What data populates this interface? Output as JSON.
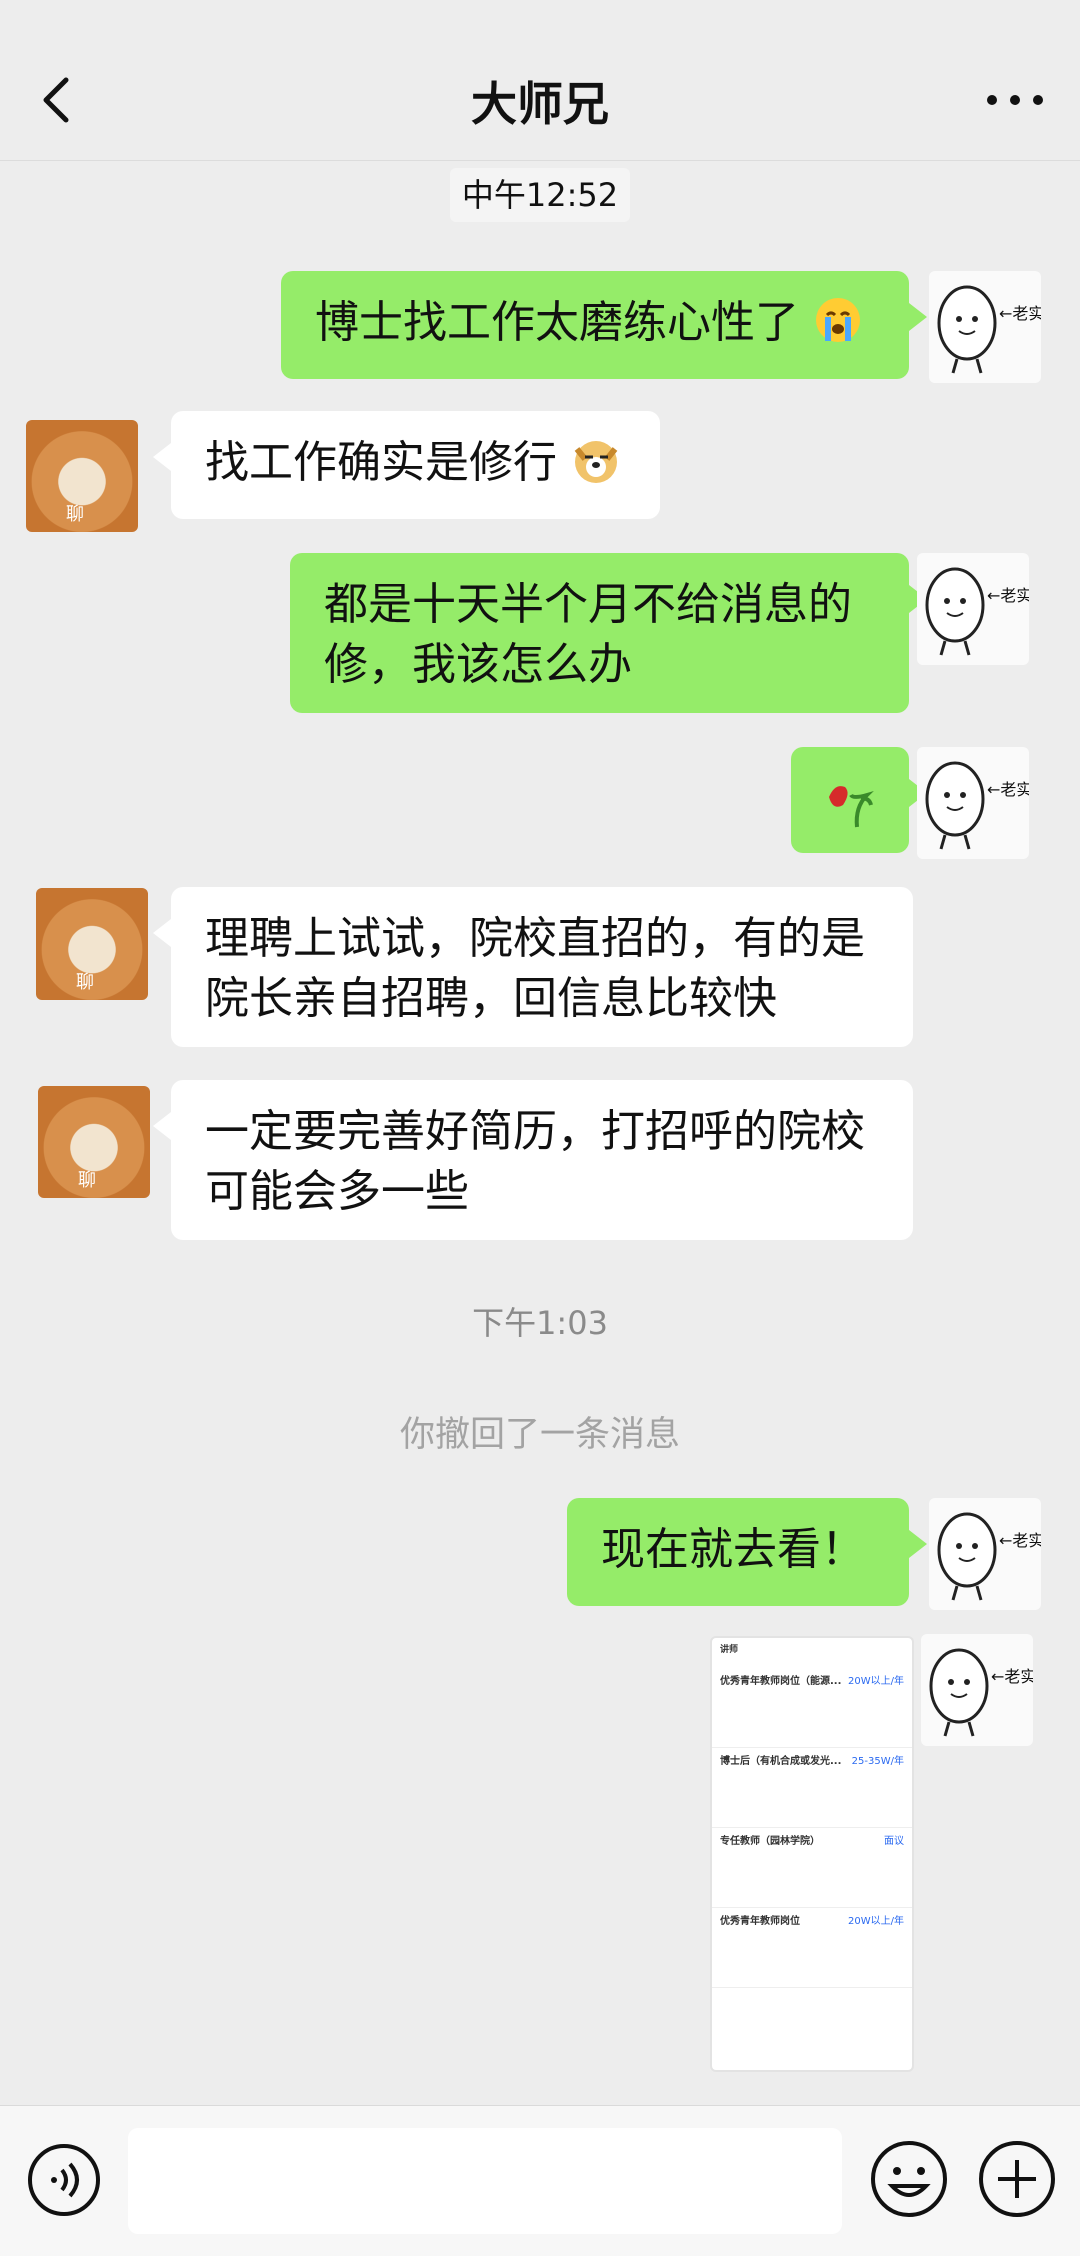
{
  "header": {
    "title": "大师兄"
  },
  "timestamps": {
    "first": "中午12:52",
    "second": "下午1:03"
  },
  "system_note": "你撤回了一条消息",
  "messages": [
    {
      "side": "out",
      "text": "博士找工作太磨练心性了",
      "emoji": "crying-face"
    },
    {
      "side": "in",
      "text": "找工作确实是修行",
      "emoji": "doge-face"
    },
    {
      "side": "out",
      "text": "都是十天半个月不给消息的修，我该怎么办"
    },
    {
      "side": "out",
      "text": "",
      "emoji": "wilted-rose"
    },
    {
      "side": "in",
      "text": "理聘上试试，院校直招的，有的是院长亲自招聘，回信息比较快"
    },
    {
      "side": "in",
      "text": "一定要完善好简历，打招呼的院校可能会多一些"
    },
    {
      "side": "out",
      "text": "现在就去看！"
    }
  ],
  "avatars": {
    "self_label": "←老实",
    "contact_label": "聊"
  },
  "screenshot_thumb": {
    "tab": "讲师",
    "rows": [
      {
        "title": "优秀青年教师岗位（能源...",
        "salary": "20W以上/年"
      },
      {
        "title": "博士后（有机合成或发光...",
        "salary": "25-35W/年"
      },
      {
        "title": "专任教师（园林学院）",
        "salary": "面议"
      },
      {
        "title": "优秀青年教师岗位",
        "salary": "20W以上/年"
      }
    ]
  },
  "icons": {
    "back": "chevron-left-icon",
    "more": "more-dots-icon",
    "voice": "voice-icon",
    "emoji": "smiley-icon",
    "plus": "plus-circle-icon"
  },
  "colors": {
    "outgoing_bubble": "#95ec69",
    "incoming_bubble": "#ffffff",
    "background": "#ededed"
  }
}
